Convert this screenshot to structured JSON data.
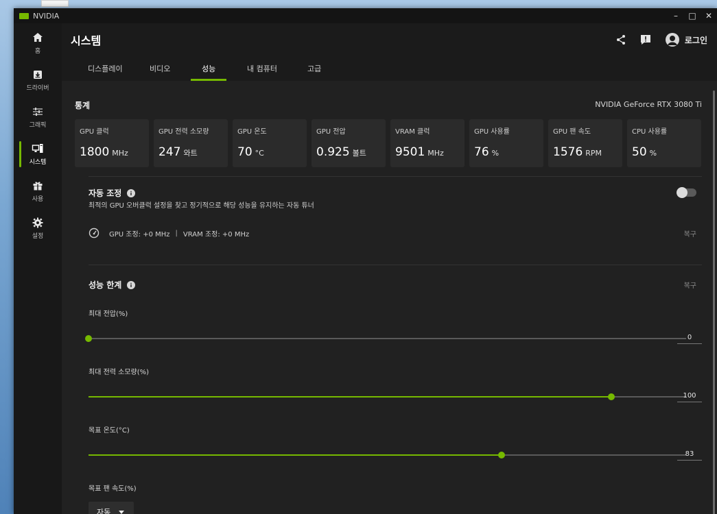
{
  "window": {
    "app_name": "NVIDIA"
  },
  "window_controls": {
    "minimize": "–",
    "maximize": "□",
    "close": "✕"
  },
  "sidebar": {
    "items": [
      {
        "label": "홈",
        "icon": "home-icon"
      },
      {
        "label": "드라이버",
        "icon": "driver-download-icon"
      },
      {
        "label": "그래픽",
        "icon": "graphics-sliders-icon"
      },
      {
        "label": "시스템",
        "icon": "system-monitor-icon",
        "active": true
      },
      {
        "label": "사용",
        "icon": "gift-icon"
      },
      {
        "label": "설정",
        "icon": "gear-icon"
      }
    ]
  },
  "header": {
    "title": "시스템",
    "login_label": "로그인"
  },
  "tabs": [
    {
      "label": "디스플레이"
    },
    {
      "label": "비디오"
    },
    {
      "label": "성능",
      "active": true
    },
    {
      "label": "내 컴퓨터"
    },
    {
      "label": "고급"
    }
  ],
  "stats": {
    "title": "통계",
    "gpu_name": "NVIDIA GeForce RTX 3080 Ti",
    "cards": [
      {
        "label": "GPU 클럭",
        "value": "1800",
        "unit": "MHz"
      },
      {
        "label": "GPU 전력 소모량",
        "value": "247",
        "unit": "와트"
      },
      {
        "label": "GPU 온도",
        "value": "70",
        "unit": "°C"
      },
      {
        "label": "GPU 전압",
        "value": "0.925",
        "unit": "볼트"
      },
      {
        "label": "VRAM 클럭",
        "value": "9501",
        "unit": "MHz"
      },
      {
        "label": "GPU 사용률",
        "value": "76",
        "unit": "%"
      },
      {
        "label": "GPU 팬 속도",
        "value": "1576",
        "unit": "RPM"
      },
      {
        "label": "CPU 사용률",
        "value": "50",
        "unit": "%"
      }
    ]
  },
  "auto_tune": {
    "title": "자동 조정",
    "description": "최적의 GPU 오버클럭 설정을 찾고 정기적으로 해당 성능을 유지하는 자동 튜너",
    "gpu_offset": "GPU 조정: +0 MHz",
    "separator": "|",
    "vram_offset": "VRAM 조정: +0 MHz",
    "reset_label": "복구",
    "enabled": false
  },
  "limits": {
    "title": "성능 한계",
    "reset_label": "복구",
    "sliders": [
      {
        "label": "최대 전압(%)",
        "value": "0",
        "fraction": 0.0
      },
      {
        "label": "최대 전력 소모량(%)",
        "value": "100",
        "fraction": 0.875
      },
      {
        "label": "목표 온도(°C)",
        "value": "83",
        "fraction": 0.691
      }
    ],
    "fan_speed": {
      "label": "목표 팬 속도(%)",
      "selected": "자동"
    }
  },
  "colors": {
    "accent": "#76b900",
    "background": "#212121",
    "card": "#2b2b2b"
  }
}
